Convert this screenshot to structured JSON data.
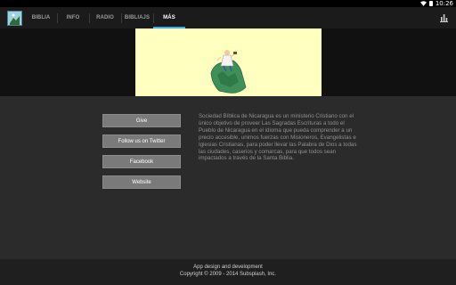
{
  "status": {
    "time": "10:26"
  },
  "tabs": [
    {
      "label": "BIBLIA"
    },
    {
      "label": "INFO"
    },
    {
      "label": "RADIO"
    },
    {
      "label": "BIBLIAJS"
    },
    {
      "label": "MÁS"
    }
  ],
  "icons": {
    "app_logo": "app-logo-icon",
    "chart": "bar-chart-icon",
    "wifi": "wifi-icon",
    "battery": "battery-icon"
  },
  "colors": {
    "accent": "#34b5e5",
    "hero_bg": "#ffffc0",
    "button_bg": "#7a7a7a"
  },
  "buttons": {
    "give": "Give",
    "twitter": "Follow us on Twitter",
    "facebook": "Facebook",
    "website": "Website"
  },
  "description": "Sociedad Bíblica de Nicaragua es un ministerio Cristiano con el único objetivo de proveer Las Sagradas Escrituras a todo el Pueblo de Nicaragua en el idioma que pueda comprender a un precio accesible, unimos fuerzas con Misioneros, Evangelistas e Iglesias Cristianas, para poder llevar las Palabra de Dios a todas las ciudades, caserios y comarcas, para que todos sean impactados a través de la Santa Biblia.",
  "footer": {
    "line1": "App design and development",
    "line2": "Copyright © 2009 - 2014 Subsplash, Inc."
  }
}
